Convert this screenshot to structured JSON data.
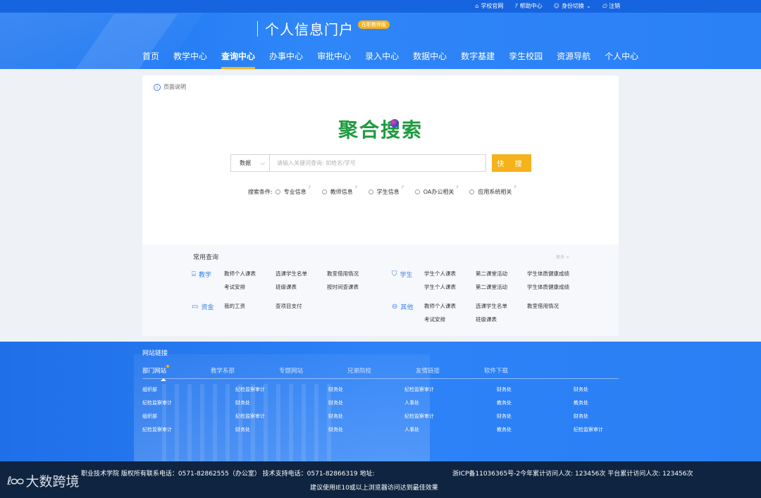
{
  "topbar": {
    "links": [
      {
        "icon": "home-icon",
        "glyph": "⌂",
        "label": "学校官网"
      },
      {
        "icon": "help-icon",
        "glyph": "?",
        "label": "帮助中心"
      },
      {
        "icon": "user-icon",
        "glyph": "☺",
        "label": "身份切换"
      },
      {
        "icon": "power-icon",
        "glyph": "⏻",
        "label": "注销"
      }
    ]
  },
  "header": {
    "title": "个人信息门户",
    "badge": "在职教师版"
  },
  "nav": {
    "items": [
      "首页",
      "教学中心",
      "查询中心",
      "办事中心",
      "审批中心",
      "录入中心",
      "数据中心",
      "数字基建",
      "孪生校园",
      "资源导航",
      "个人中心"
    ],
    "active_index": 2
  },
  "card": {
    "page_info": "页面说明",
    "logo_title": "聚合搜索",
    "search": {
      "select_value": "数据",
      "placeholder": "请输入关键词查询: 如姓名/学号",
      "button": "快 搜"
    },
    "conditions": {
      "label": "搜索条件:",
      "options": [
        "专业信息",
        "教师信息",
        "学生信息",
        "OA办公相关",
        "应用系统相关"
      ]
    }
  },
  "common": {
    "title": "常用查询",
    "more": "更多 >",
    "groups": {
      "teaching": {
        "name": "教学",
        "items": [
          "教师个人课表",
          "选课学生名单",
          "教室借用情况",
          "考试安排",
          "班级课表",
          "按时间查课表"
        ]
      },
      "student": {
        "name": "学生",
        "items": [
          "学生个人课表",
          "第二课堂活动",
          "学生体质健康成绩",
          "学生个人课表",
          "第二课堂活动",
          "学生体质健康成绩"
        ]
      },
      "funds": {
        "name": "资金",
        "items": [
          "我的工资",
          "查项目支付"
        ]
      },
      "other": {
        "name": "其他",
        "items": [
          "教师个人课表",
          "选课学生名单",
          "教室借用情况",
          "考试安排",
          "班级课表"
        ]
      }
    }
  },
  "site_links": {
    "title": "网站链接",
    "tabs": [
      "部门网站",
      "教学系部",
      "专题网站",
      "兄弟院校",
      "友情链接",
      "软件下载"
    ],
    "active_tab": 0,
    "grid": [
      [
        "组织部",
        "纪检监察审计",
        "财务处",
        "纪检监察审计",
        "财务处",
        "财务处"
      ],
      [
        "纪检监察审计",
        "财务处",
        "财务处",
        "人事处",
        "教务处",
        "教务处"
      ],
      [
        "组织部",
        "纪检监察审计",
        "财务处",
        "纪检监察审计",
        "财务处",
        "财务处"
      ],
      [
        "纪检监察审计",
        "财务处",
        "财务处",
        "人事处",
        "教务处",
        "纪检监察审计"
      ]
    ]
  },
  "footer": {
    "line1_left": "职业技术学院 版权所有联系电话：0571-82862555（办公室） 技术支持电话：0571-82866319 地址:",
    "line1_right": "浙ICP备11036365号-2今年累计访问人次: 123456次  平台累计访问人次: 123456次",
    "line2": "建议使用IE10或以上浏览器访问达到最佳效果",
    "watermark": "大数跨境"
  },
  "colors": {
    "primary": "#2a80f5",
    "accent": "#f6b21b",
    "logo_green": "#1e9b3f",
    "footer_bg": "#0f2440"
  }
}
